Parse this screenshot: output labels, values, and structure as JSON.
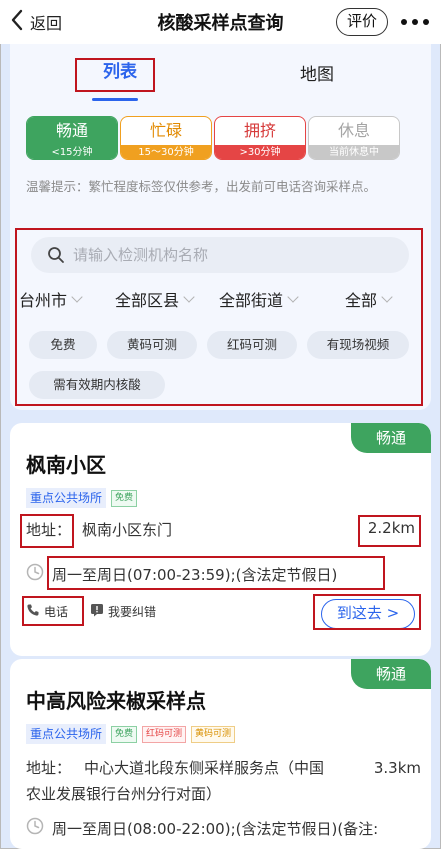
{
  "nav": {
    "back_label": "返回",
    "title": "核酸采样点查询",
    "rate_label": "评价"
  },
  "tabs": [
    {
      "label": "列表"
    },
    {
      "label": "地图"
    }
  ],
  "legend": [
    {
      "label": "畅通",
      "range": "<15分钟",
      "color": "#3ea45f"
    },
    {
      "label": "忙碌",
      "range": "15～30分钟",
      "color": "#f0a020"
    },
    {
      "label": "拥挤",
      "range": ">30分钟",
      "color": "#e54545"
    },
    {
      "label": "休息",
      "range": "当前休息中",
      "color": "#c8c8c8"
    }
  ],
  "hint": "温馨提示：繁忙程度标签仅供参考，出发前可电话咨询采样点。",
  "search": {
    "placeholder": "请输入检测机构名称"
  },
  "dropdowns": {
    "city": "台州市",
    "county": "全部区县",
    "street": "全部街道",
    "all": "全部"
  },
  "chips": [
    "免费",
    "黄码可测",
    "红码可测",
    "有现场视频",
    "需有效期内核酸"
  ],
  "cards": [
    {
      "status": "畅通",
      "name": "枫南小区",
      "type": "重点公共场所",
      "tag_free": "免费",
      "address_label": "地址：",
      "address": "枫南小区东门",
      "distance": "2.2km",
      "hours": "周一至周日(07:00-23:59);(含法定节假日)",
      "phone_label": "电话",
      "report_label": "我要纠错",
      "go_label": "到这去 >"
    },
    {
      "status": "畅通",
      "name": "中高风险来椒采样点",
      "type": "重点公共场所",
      "tag_free": "免费",
      "tag_red": "红码可测",
      "tag_yellow": "黄码可测",
      "address_label": "地址：",
      "address_line1": "中心大道北段东侧采样服务点（中国",
      "address_line2": "农业发展银行台州分行对面）",
      "distance": "3.3km",
      "hours": "周一至周日(08:00-22:00);(含法定节假日)(备注:"
    }
  ],
  "colors": {
    "accent": "#2b64ec",
    "status_green": "#3ea45f",
    "highlight_red": "#c0151e",
    "background": "#dfe9fb"
  }
}
